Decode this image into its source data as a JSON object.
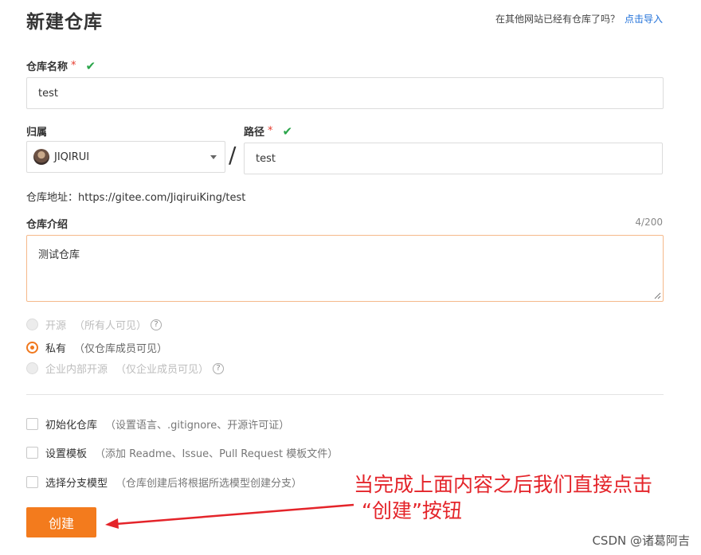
{
  "page": {
    "title": "新建仓库",
    "import_hint": "在其他网站已经有仓库了吗？",
    "import_link": "点击导入"
  },
  "form": {
    "repo_name": {
      "label": "仓库名称",
      "required": "*",
      "value": "test"
    },
    "owner": {
      "label": "归属",
      "value": "JIQIRUI"
    },
    "separator": "/",
    "path": {
      "label": "路径",
      "required": "*",
      "value": "test"
    },
    "repo_url": "仓库地址：https://gitee.com/JiqiruiKing/test",
    "description": {
      "label": "仓库介绍",
      "counter": "4/200",
      "value": "测试仓库"
    },
    "visibility": [
      {
        "label": "开源",
        "hint": "（所有人可见）",
        "checked": false,
        "disabled": true,
        "has_help": true
      },
      {
        "label": "私有",
        "hint": "（仅仓库成员可见）",
        "checked": true,
        "disabled": false,
        "has_help": false
      },
      {
        "label": "企业内部开源",
        "hint": "（仅企业成员可见）",
        "checked": false,
        "disabled": true,
        "has_help": true
      }
    ],
    "options": [
      {
        "label": "初始化仓库",
        "sub": "（设置语言、.gitignore、开源许可证）"
      },
      {
        "label": "设置模板",
        "sub": "（添加 Readme、Issue、Pull Request 模板文件）"
      },
      {
        "label": "选择分支模型",
        "sub": "（仓库创建后将根据所选模型创建分支）"
      }
    ],
    "submit_label": "创建"
  },
  "annotation": {
    "line1": "当完成上面内容之后我们直接点击",
    "line2": "“创建”按钮"
  },
  "watermark": "CSDN @诸葛阿吉",
  "colors": {
    "accent": "#f37b1d",
    "link": "#1e6fd9",
    "required": "#e63b2e",
    "valid_check": "#2aa54a",
    "annotation": "#e4242a"
  },
  "icons": {
    "check": "✔",
    "help": "?"
  }
}
